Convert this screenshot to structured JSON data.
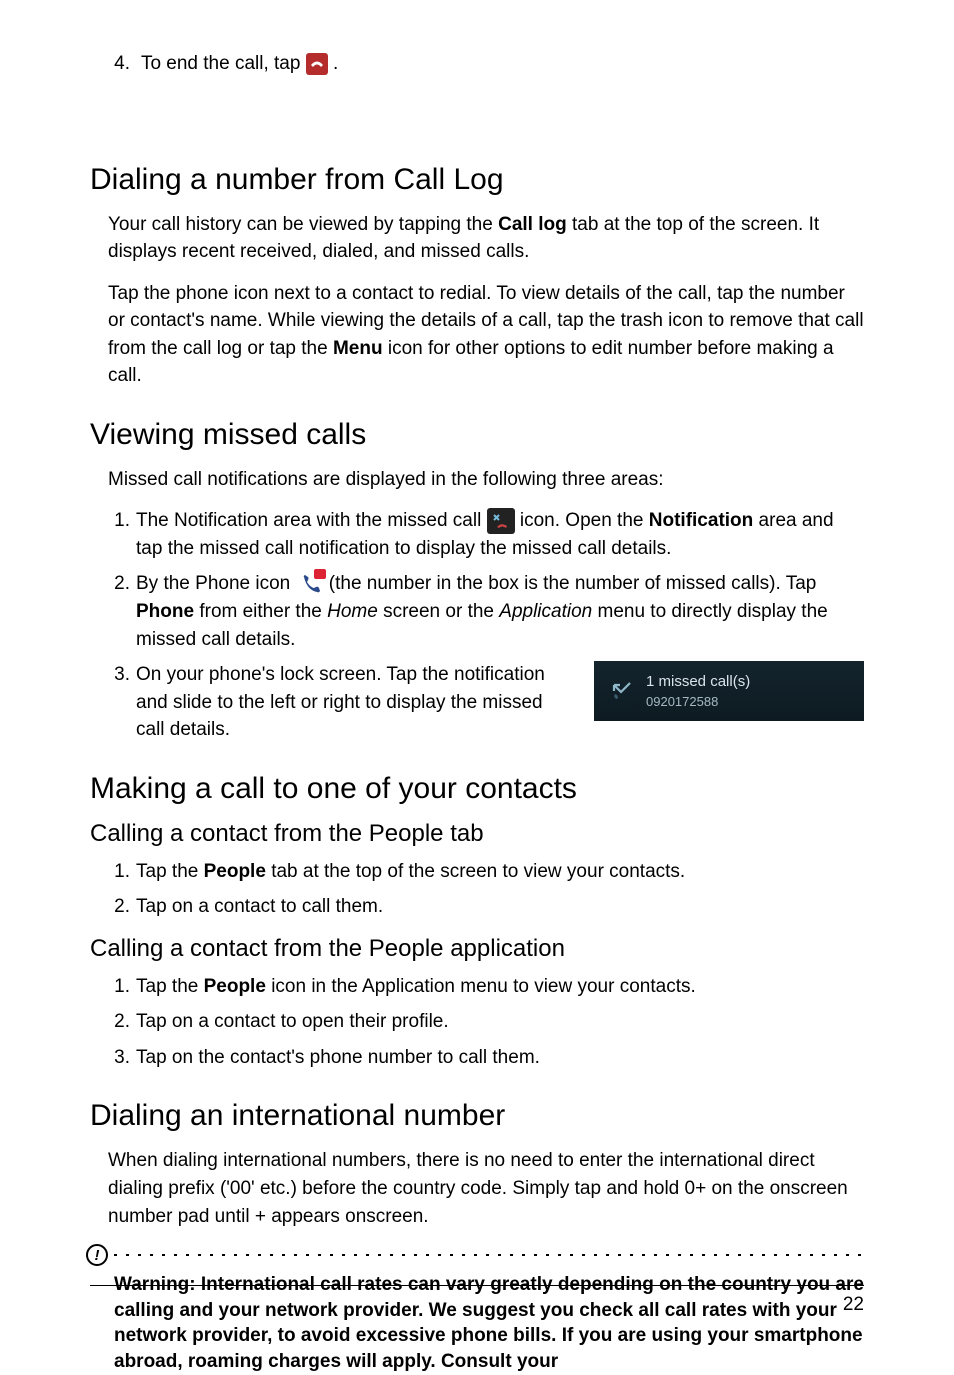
{
  "intro": {
    "step4_pre": "To end the call, tap ",
    "step4_post": "."
  },
  "sec1": {
    "heading": "Dialing a number from Call Log",
    "p1_a": "Your call history can be viewed by tapping the ",
    "p1_bold": "Call log",
    "p1_b": " tab at the top of the screen. It displays recent received, dialed, and missed calls.",
    "p2_a": "Tap the phone icon next to a contact to redial. To view details of the call, tap the number or contact's name. While viewing the details of a call, tap the trash icon to remove that call from the call log or tap the ",
    "p2_bold": "Menu",
    "p2_b": " icon for other options to edit number before making a call."
  },
  "sec2": {
    "heading": "Viewing missed calls",
    "intro": "Missed call notifications are displayed in the following three areas:",
    "li1_a": "The Notification area with the missed call ",
    "li1_b": " icon. Open the ",
    "li1_bold": "Notification",
    "li1_c": " area and tap the missed call notification to display the missed call details.",
    "li2_a": "By the Phone icon ",
    "li2_b": " (the number in the box is the number of missed calls). Tap ",
    "li2_bold": "Phone",
    "li2_c": " from either the ",
    "li2_i1": "Home",
    "li2_d": " screen or the ",
    "li2_i2": "Application",
    "li2_e": " menu to directly display the missed call details.",
    "li3": "On your phone's lock screen. Tap the notification and slide to the left or right to display the missed call details.",
    "widget": {
      "line1": "1 missed call(s)",
      "line2": "0920172588"
    }
  },
  "sec3": {
    "heading": "Making a call to one of your contacts",
    "sub1": {
      "heading": "Calling a contact from the People tab",
      "li1_a": "Tap the ",
      "li1_bold": "People",
      "li1_b": " tab at the top of the screen to view your contacts.",
      "li2": "Tap on a contact to call them."
    },
    "sub2": {
      "heading": "Calling a contact from the People application",
      "li1_a": "Tap the ",
      "li1_bold": "People",
      "li1_b": " icon in the Application menu to view your contacts.",
      "li2": "Tap on a contact to open their profile.",
      "li3": "Tap on the contact's phone number to call them."
    }
  },
  "sec4": {
    "heading": "Dialing an international number",
    "p1": "When dialing international numbers, there is no need to enter the international direct dialing prefix ('00' etc.) before the country code. Simply tap and hold 0+ on the onscreen number pad until + appears onscreen.",
    "warning": "Warning: International call rates can vary greatly depending on the country you are calling and your network provider. We suggest you check all call rates with your network provider, to avoid excessive phone bills. If you are using your smartphone abroad, roaming charges will apply. Consult your"
  },
  "page_number": "22"
}
